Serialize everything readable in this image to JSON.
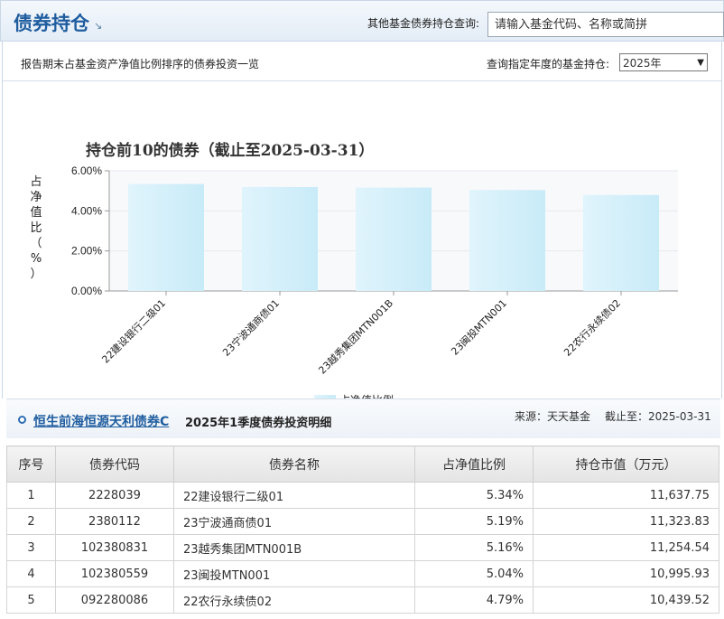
{
  "header": {
    "title": "债券持仓",
    "title_arrow": "↘",
    "query_label": "其他基金债券持仓查询:",
    "search_placeholder": "请输入基金代码、名称或简拼"
  },
  "subbar": {
    "description": "报告期末占基金资产净值比例排序的债券投资一览",
    "year_label": "查询指定年度的基金持仓:",
    "year_selected": "2025年"
  },
  "chart_data": {
    "type": "bar",
    "title": "持仓前10的债券（截止至2025-03-31）",
    "ylabel": "占净值比（%）",
    "ylim": [
      0,
      6
    ],
    "yticks": [
      "0.00%",
      "2.00%",
      "4.00%",
      "6.00%"
    ],
    "categories": [
      "22建设银行二级01",
      "23宁波通商债01",
      "23越秀集团MTN001B",
      "23闽投MTN001",
      "22农行永续债02"
    ],
    "series": [
      {
        "name": "占净值比例",
        "values": [
          5.34,
          5.19,
          5.16,
          5.04,
          4.79
        ]
      }
    ],
    "grid": true,
    "legend": "bottom",
    "bar_color": "#c8ebf8"
  },
  "detail": {
    "fund_name": "恒生前海恒源天利债券C",
    "title": "2025年1季度债券投资明细",
    "source": "来源：天天基金",
    "as_of": "截止至：2025-03-31"
  },
  "table": {
    "columns": [
      "序号",
      "债券代码",
      "债券名称",
      "占净值比例",
      "持仓市值（万元）"
    ],
    "rows": [
      [
        "1",
        "2228039",
        "22建设银行二级01",
        "5.34%",
        "11,637.75"
      ],
      [
        "2",
        "2380112",
        "23宁波通商债01",
        "5.19%",
        "11,323.83"
      ],
      [
        "3",
        "102380831",
        "23越秀集团MTN001B",
        "5.16%",
        "11,254.54"
      ],
      [
        "4",
        "102380559",
        "23闽投MTN001",
        "5.04%",
        "10,995.93"
      ],
      [
        "5",
        "092280086",
        "22农行永续债02",
        "4.79%",
        "10,439.52"
      ]
    ]
  }
}
